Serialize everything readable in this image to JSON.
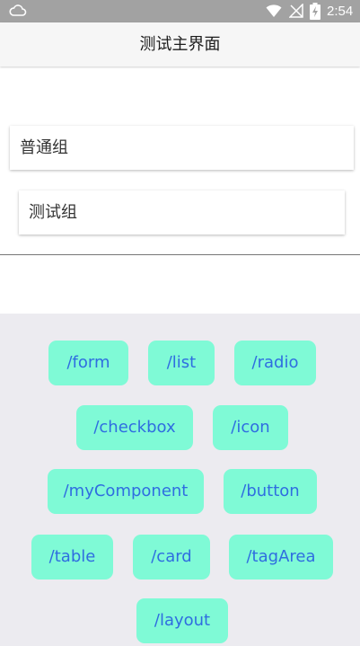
{
  "status_bar": {
    "time": "2:54",
    "icons": [
      "cloud-icon",
      "wifi-icon",
      "signal-off-icon",
      "battery-charging-icon"
    ]
  },
  "header": {
    "title": "测试主界面"
  },
  "groups": [
    {
      "label": "普通组"
    },
    {
      "label": "测试组"
    }
  ],
  "routes": [
    {
      "label": "/form"
    },
    {
      "label": "/list"
    },
    {
      "label": "/radio"
    },
    {
      "label": "/checkbox"
    },
    {
      "label": "/icon"
    },
    {
      "label": "/myComponent"
    },
    {
      "label": "/button"
    },
    {
      "label": "/table"
    },
    {
      "label": "/card"
    },
    {
      "label": "/tagArea"
    },
    {
      "label": "/layout"
    }
  ],
  "colors": {
    "status_bar_bg": "#a2a2a2",
    "title_bar_bg": "#f6f6f6",
    "route_area_bg": "#ecebf0",
    "route_button_bg": "#7ffad6",
    "route_button_text": "#2f6de0"
  }
}
